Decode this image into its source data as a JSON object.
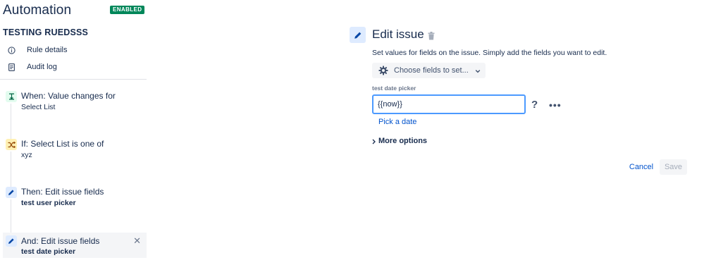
{
  "app": {
    "title": "Automation",
    "status_badge": "ENABLED"
  },
  "rule": {
    "name": "TESTING RUEDSSS"
  },
  "nav": {
    "items": [
      {
        "label": "Rule details",
        "icon": "info-icon"
      },
      {
        "label": "Audit log",
        "icon": "document-icon"
      }
    ]
  },
  "steps": [
    {
      "title": "When: Value changes for",
      "subtitle": "Select List",
      "icon": "trigger-icon"
    },
    {
      "title": "If: Select List is one of",
      "subtitle": "xyz",
      "icon": "shuffle-icon"
    },
    {
      "title": "Then: Edit issue fields",
      "subtitle": "test user picker",
      "icon": "pencil-icon"
    },
    {
      "title": "And: Edit issue fields",
      "subtitle": "test date picker",
      "icon": "pencil-icon",
      "selected": true
    }
  ],
  "panel": {
    "title": "Edit issue",
    "description": "Set values for fields on the issue. Simply add the fields you want to edit.",
    "choose_fields_label": "Choose fields to set...",
    "field": {
      "label": "test date picker",
      "value": "{{now}}",
      "help": "?",
      "more": "•••"
    },
    "pick_date_link": "Pick a date",
    "more_options_label": "More options",
    "cancel_label": "Cancel",
    "save_label": "Save"
  },
  "colors": {
    "badge_green": "#00875a",
    "link_blue": "#0052cc",
    "focus_blue": "#4c9aff",
    "text_dark": "#172b4d"
  }
}
